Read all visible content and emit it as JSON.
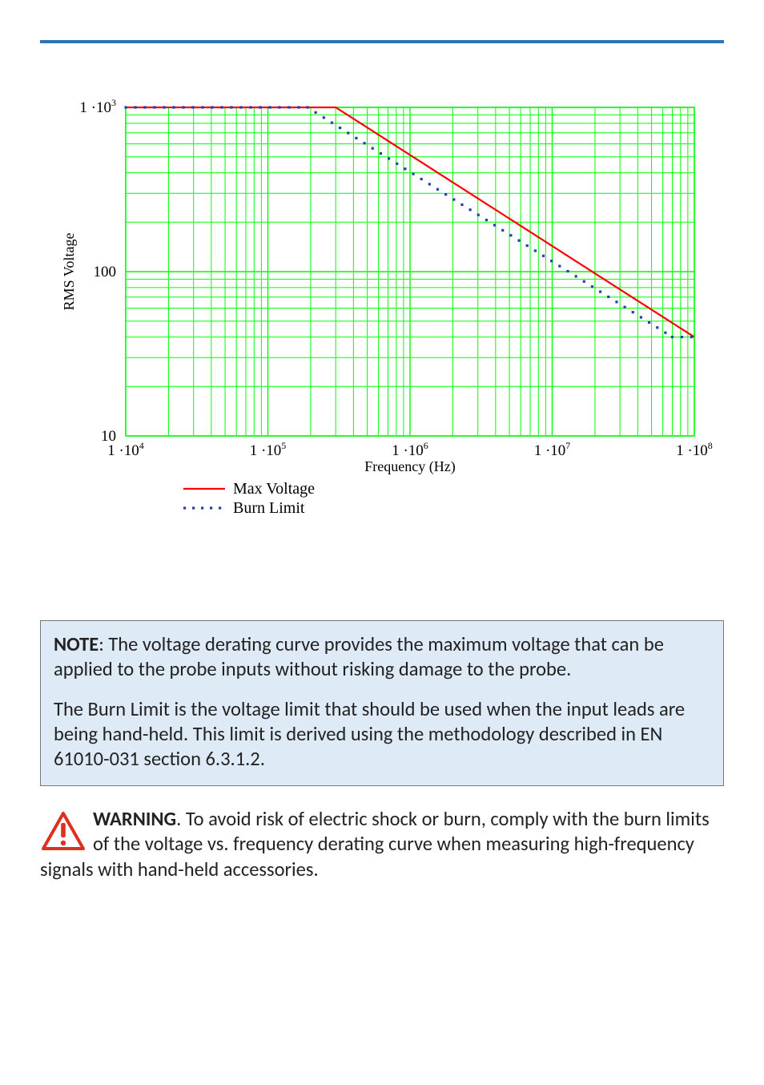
{
  "chart_data": {
    "type": "line",
    "xlabel": "Frequency (Hz)",
    "ylabel": "RMS Voltage",
    "xscale": "log",
    "yscale": "log",
    "xlim": [
      10000.0,
      100000000.0
    ],
    "ylim": [
      10,
      1000
    ],
    "xticks_exp": [
      4,
      5,
      6,
      7,
      8
    ],
    "yticks": [
      10,
      100,
      1000
    ],
    "series": [
      {
        "name": "Max Voltage",
        "style": "solid",
        "color": "#ff0000",
        "data": [
          {
            "x": 10000.0,
            "y": 1000
          },
          {
            "x": 300000.0,
            "y": 1000
          },
          {
            "x": 100000000.0,
            "y": 40
          }
        ]
      },
      {
        "name": "Burn Limit",
        "style": "dotted",
        "color": "#1f3fb4",
        "data": [
          {
            "x": 10000.0,
            "y": 1000
          },
          {
            "x": 190000.0,
            "y": 1000
          },
          {
            "x": 70000000.0,
            "y": 40
          },
          {
            "x": 100000000.0,
            "y": 40
          }
        ]
      }
    ],
    "legend": {
      "position": "bottom-left",
      "items": [
        "Max Voltage",
        "Burn Limit"
      ]
    }
  },
  "note": {
    "label": "NOTE",
    "p1_rest": ": The voltage derating curve provides the maximum voltage that can be applied to the probe inputs without risking damage to the probe.",
    "p2": "The Burn Limit is the voltage limit that should be used when the input leads are being hand-held. This limit is derived using the methodology described in EN 61010-031 section 6.3.1.2."
  },
  "warning": {
    "label": "WARNING",
    "rest": ". To avoid risk of electric shock or burn, comply with the burn limits of the voltage vs. frequency derating curve when measuring high-frequency signals with hand-held accessories."
  }
}
